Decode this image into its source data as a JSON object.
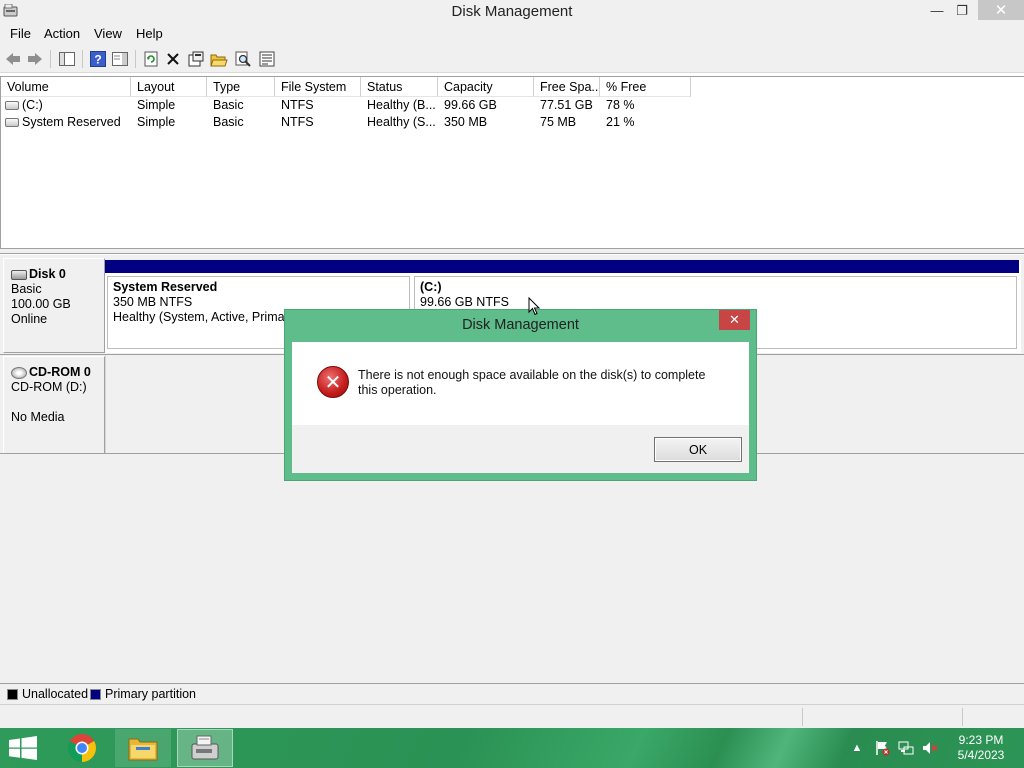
{
  "window": {
    "title": "Disk Management",
    "controls": {
      "minimize": "—",
      "maximize": "❐",
      "close": "✕"
    }
  },
  "menu": [
    "File",
    "Action",
    "View",
    "Help"
  ],
  "toolbar_icons": [
    "back-icon",
    "forward-icon",
    "console-tree-icon",
    "help-icon",
    "properties-view-icon",
    "refresh-icon",
    "delete-icon",
    "properties-icon",
    "open-icon",
    "search-icon",
    "rescan-icon"
  ],
  "volume_list": {
    "columns": [
      "Volume",
      "Layout",
      "Type",
      "File System",
      "Status",
      "Capacity",
      "Free Spa...",
      "% Free"
    ],
    "rows": [
      {
        "volume": "(C:)",
        "layout": "Simple",
        "type": "Basic",
        "fs": "NTFS",
        "status": "Healthy (B...",
        "capacity": "99.66 GB",
        "free": "77.51 GB",
        "pct": "78 %"
      },
      {
        "volume": "System Reserved",
        "layout": "Simple",
        "type": "Basic",
        "fs": "NTFS",
        "status": "Healthy (S...",
        "capacity": "350 MB",
        "free": "75 MB",
        "pct": "21 %"
      }
    ]
  },
  "disks": {
    "disk0": {
      "name": "Disk 0",
      "type": "Basic",
      "size": "100.00 GB",
      "status": "Online",
      "partitions": [
        {
          "name": "System Reserved",
          "size": "350 MB NTFS",
          "status": "Healthy (System, Active, Primary"
        },
        {
          "name": "(C:)",
          "size": "99.66 GB NTFS",
          "status": ""
        }
      ]
    },
    "cdrom0": {
      "name": "CD-ROM 0",
      "drive": "CD-ROM (D:)",
      "media": "No Media"
    }
  },
  "legend": [
    {
      "label": "Unallocated",
      "color": "#000000"
    },
    {
      "label": "Primary partition",
      "color": "#000080"
    }
  ],
  "dialog": {
    "title": "Disk Management",
    "close": "✕",
    "icon": "error-icon",
    "message": "There is not enough space available on the disk(s) to complete this operation.",
    "ok_label": "OK"
  },
  "taskbar": {
    "apps": [
      "windows-start-icon",
      "chrome-icon",
      "file-explorer-icon",
      "disk-management-icon"
    ],
    "tray": {
      "show_hidden": "▲",
      "time": "9:23 PM",
      "date": "5/4/2023"
    }
  },
  "colors": {
    "accent_green": "#2f9b5a",
    "dialog_frame": "#5ebd8b",
    "partition_primary": "#000080",
    "close_red": "#c74545"
  }
}
